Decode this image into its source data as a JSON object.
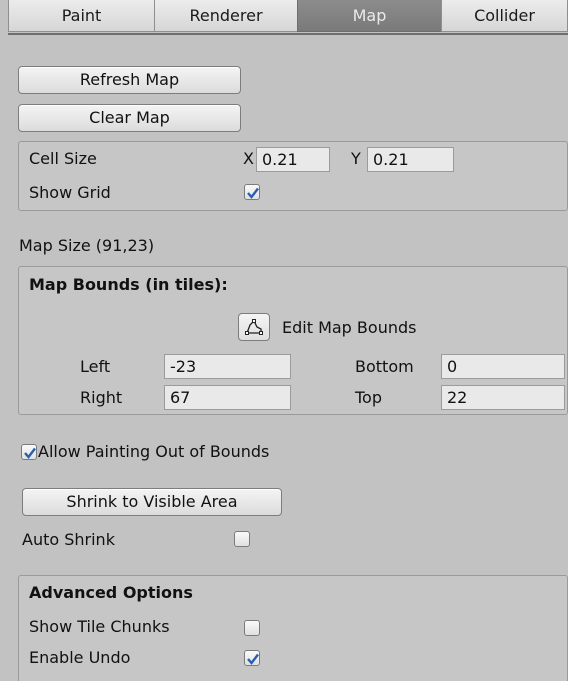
{
  "tabs": [
    {
      "label": "Paint",
      "active": false
    },
    {
      "label": "Renderer",
      "active": false
    },
    {
      "label": "Map",
      "active": true
    },
    {
      "label": "Collider",
      "active": false
    }
  ],
  "actions": {
    "refresh_map": "Refresh Map",
    "clear_map": "Clear Map"
  },
  "cell_settings": {
    "cell_size_label": "Cell Size",
    "x_label": "X",
    "x_value": "0.21",
    "y_label": "Y",
    "y_value": "0.21",
    "show_grid_label": "Show Grid",
    "show_grid": true
  },
  "map_size": "Map Size (91,23)",
  "map_bounds": {
    "title": "Map Bounds (in tiles):",
    "edit_label": "Edit Map Bounds",
    "edit_icon": "polygon-edit-icon",
    "left_label": "Left",
    "left_value": "-23",
    "right_label": "Right",
    "right_value": "67",
    "bottom_label": "Bottom",
    "bottom_value": "0",
    "top_label": "Top",
    "top_value": "22"
  },
  "allow_painting": {
    "label": "Allow Painting Out of Bounds",
    "checked": true
  },
  "shrink": {
    "button": "Shrink to Visible Area",
    "auto_label": "Auto Shrink",
    "auto_checked": false
  },
  "advanced": {
    "title": "Advanced Options",
    "show_chunks_label": "Show Tile Chunks",
    "show_chunks": false,
    "enable_undo_label": "Enable Undo",
    "enable_undo": true
  },
  "colors": {
    "accent_check": "#2a5fb0",
    "panel": "#c2c2c2",
    "active_tab": "#828282"
  }
}
